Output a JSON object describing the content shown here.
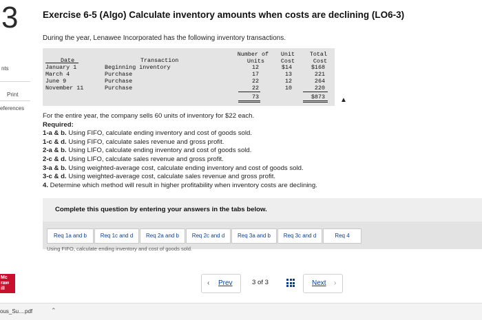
{
  "sidebar": {
    "question_number": "3",
    "points_label": "nts",
    "print_label": "Print",
    "references_label": "eferences",
    "logo_text": [
      "Mc",
      "raw",
      "ill"
    ]
  },
  "header": {
    "title": "Exercise 6-5 (Algo) Calculate inventory amounts when costs are declining (LO6-3)"
  },
  "intro": "During the year, Lenawee Incorporated has the following inventory transactions.",
  "inventory_table": {
    "headers": {
      "date": "Date",
      "transaction": "Transaction",
      "units_line1": "Number of",
      "units_line2": "Units",
      "unit_cost_line1": "Unit",
      "unit_cost_line2": "Cost",
      "total_cost_line1": "Total",
      "total_cost_line2": "Cost"
    },
    "rows": [
      {
        "date": "January 1",
        "transaction": "Beginning inventory",
        "units": "12",
        "unit_cost": "$14",
        "total_cost": "$168"
      },
      {
        "date": "March 4",
        "transaction": "Purchase",
        "units": "17",
        "unit_cost": "13",
        "total_cost": "221"
      },
      {
        "date": "June 9",
        "transaction": "Purchase",
        "units": "22",
        "unit_cost": "12",
        "total_cost": "264"
      },
      {
        "date": "November 11",
        "transaction": "Purchase",
        "units": "22",
        "unit_cost": "10",
        "total_cost": "220"
      }
    ],
    "totals": {
      "units": "73",
      "total_cost": "$873"
    }
  },
  "question": {
    "sale_statement": "For the entire year, the company sells 60 units of inventory for $22 each.",
    "required_label": "Required:",
    "items": [
      {
        "label": "1-a & b.",
        "text": " Using FIFO, calculate ending inventory and cost of goods sold."
      },
      {
        "label": "1-c & d.",
        "text": " Using FIFO, calculate sales revenue and gross profit."
      },
      {
        "label": "2-a & b.",
        "text": " Using LIFO, calculate ending inventory and cost of goods sold."
      },
      {
        "label": "2-c & d.",
        "text": " Using LIFO, calculate sales revenue and gross profit."
      },
      {
        "label": "3-a & b.",
        "text": " Using weighted-average cost, calculate ending inventory and cost of goods sold."
      },
      {
        "label": "3-c & d.",
        "text": " Using weighted-average cost, calculate sales revenue and gross profit."
      },
      {
        "label": "4.",
        "text": " Determine which method will result in higher profitability when inventory costs are declining."
      }
    ]
  },
  "instructions": "Complete this question by entering your answers in the tabs below.",
  "tabs": [
    {
      "label": "Req 1a and b"
    },
    {
      "label": "Req 1c and d"
    },
    {
      "label": "Req 2a and b"
    },
    {
      "label": "Req 2c and d"
    },
    {
      "label": "Req 3a and b"
    },
    {
      "label": "Req 3c and d"
    },
    {
      "label": "Req 4"
    }
  ],
  "tab_subtitle": "Using FIFO, calculate ending inventory and cost of goods sold.",
  "navigation": {
    "prev_label": "Prev",
    "next_label": "Next",
    "current_page": "3",
    "total_pages": "3",
    "page_indicator": "3 of 3"
  },
  "download_bar": {
    "file_name": "ous_Su....pdf"
  }
}
